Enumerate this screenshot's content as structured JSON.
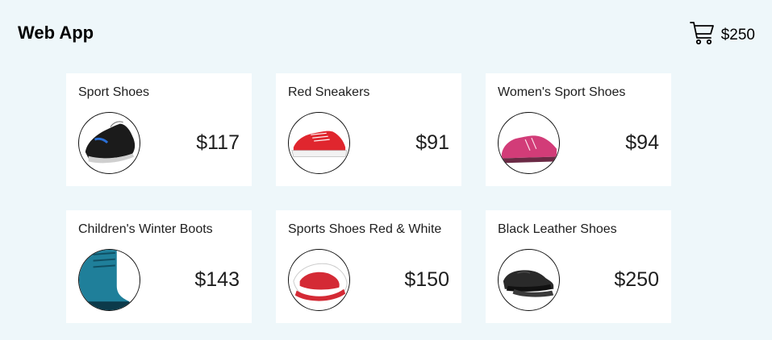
{
  "header": {
    "title": "Web App",
    "cart_icon": "shopping-cart-icon",
    "cart_total": "$250"
  },
  "products": [
    {
      "name": "Sport Shoes",
      "price": "$117",
      "image": "black-running-shoe",
      "color": "#1a1a1a"
    },
    {
      "name": "Red Sneakers",
      "price": "$91",
      "image": "red-canvas-sneaker",
      "color": "#e0262e"
    },
    {
      "name": "Women's Sport Shoes",
      "price": "$94",
      "image": "pink-running-shoe",
      "color": "#d23c78"
    },
    {
      "name": "Children's Winter Boots",
      "price": "$143",
      "image": "teal-winter-boot",
      "color": "#1f7f9a"
    },
    {
      "name": "Sports Shoes Red & White",
      "price": "$150",
      "image": "red-white-sneaker",
      "color": "#d42a35"
    },
    {
      "name": "Black Leather Shoes",
      "price": "$250",
      "image": "black-leather-shoe",
      "color": "#222222"
    }
  ]
}
